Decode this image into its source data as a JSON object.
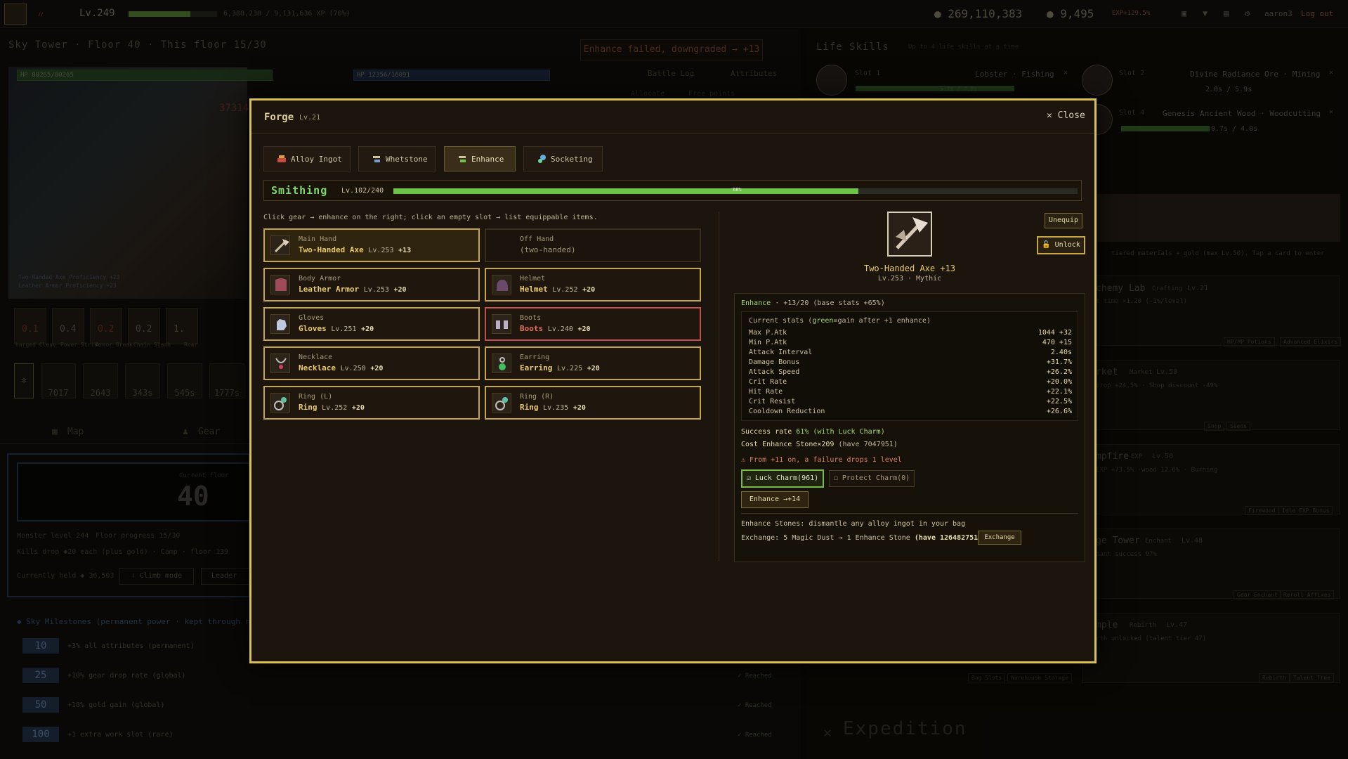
{
  "topbar": {
    "level": "Lv.249",
    "xp_text": "6,388,230 / 9,131,636 XP (70%)",
    "xp_progress": 0.7,
    "gold": "● 269,110,383",
    "gems": "● 9,495",
    "exp_bonus": "EXP+129.5%",
    "user": "aaron3",
    "logout": "Log out"
  },
  "left": {
    "breadcrumb": "Sky Tower · Floor 40 · This floor 15/30",
    "fail_message": "Enhance failed, downgraded → +13",
    "hp_player": "HP 80265/80265",
    "hp_enemy": "HP 12356/16091",
    "battle_log": "Battle Log",
    "attributes": "Attributes",
    "allocate": "Allocate",
    "free_points": "Free points",
    "damage_popup": "373146",
    "proficiency_1": "Two-Handed Axe Proficiency +23",
    "proficiency_2": "Leather Armor Proficiency +23",
    "skills": [
      {
        "name": "harged Cleav",
        "value": "0.1"
      },
      {
        "name": "Power Strike",
        "value": "0.4"
      },
      {
        "name": "Armor Break",
        "value": "0.2"
      },
      {
        "name": "Chain Slash",
        "value": "0.2"
      },
      {
        "name": "Roar",
        "value": "1."
      }
    ],
    "potions": [
      "7017",
      "2643",
      "343s",
      "545s",
      "1777s"
    ],
    "tab_map": "Map",
    "tab_gear": "Gear",
    "current_floor_label": "Current floor",
    "current_floor": "40",
    "monster_level": "Monster level 244",
    "floor_progress": "Floor progress 15/30",
    "kills_drop": "Kills drop ◆20 each (plus gold) · Camp · floor 139",
    "currently_held": "Currently held ◆ 36,503",
    "climb": "Climb mode",
    "leader": "Leader",
    "milestones_title": "◆ Sky Milestones (permanent power · kept through rebir",
    "milestones": [
      {
        "floor": "10",
        "text": "+3% all attributes (permanent)",
        "status": "✓ Reached"
      },
      {
        "floor": "25",
        "text": "+10% gear drop rate (global)",
        "status": "✓ Reached"
      },
      {
        "floor": "50",
        "text": "+10% gold gain (global)",
        "status": "✓ Reached"
      },
      {
        "floor": "100",
        "text": "+1 extra work slot (rare)",
        "status": "✓ Reached"
      }
    ]
  },
  "right": {
    "title": "Life Skills",
    "subtitle": "Up to 4 life skills at a time",
    "slot1_label": "Slot 1",
    "slot1_job": "Lobster · Fishing",
    "slot1_time": "5.7s / 7.8s",
    "slot2_label": "Slot 2",
    "slot2_job": "Divine Radiance Ore · Mining",
    "slot2_time": "2.0s / 5.9s",
    "slot4_label": "Slot 4",
    "slot4_job": "Genesis Ancient Wood · Woodcutting",
    "slot4_time": "0.7s / 4.0s",
    "materials_hint": "tiered materials + gold (max Lv.50). Tap a card to enter",
    "cards": [
      {
        "title": "chemy Lab",
        "tag": "Crafting",
        "lv": "Lv.21",
        "sub": "t time ×1.20 (-1%/level)",
        "b1": "HP/MP Potions",
        "b2": "Advanced Elixirs"
      },
      {
        "title": "rket",
        "tag": "Market",
        "lv": "Lv.50",
        "sub": "drop +24.5% · Shop discount -49%",
        "b1": "Shop",
        "b2": "Seeds"
      },
      {
        "title": "mpfire",
        "tag": "EXP",
        "lv": "Lv.50",
        "sub": "EXP +73.5% ·wood 12.6% · Burning",
        "b1": "Firewood",
        "b2": "Idle EXP Bonus"
      },
      {
        "title": "ge Tower",
        "tag": "Enchant",
        "lv": "Lv.48",
        "sub": "hant success 97%",
        "b1": "Gear Enchant",
        "b2": "Reroll Affixes"
      },
      {
        "title": "mple",
        "tag": "Rebirth",
        "lv": "Lv.47",
        "sub": "rth unlocked (talent tier 47)",
        "b1": "Rebirth",
        "b2": "Talent Tree"
      }
    ],
    "bag_slots": "Bag Slots",
    "warehouse": "Warehouse Storage",
    "expedition": "Expedition"
  },
  "forge": {
    "title": "Forge",
    "level": "Lv.21",
    "close": "✕ Close",
    "tabs": [
      "Alloy Ingot",
      "Whetstone",
      "Enhance",
      "Socketing"
    ],
    "active_tab": "Enhance",
    "smithing_title": "Smithing",
    "smithing_level": "Lv.102/240",
    "smithing_progress": 0.68,
    "smithing_mid": "68%",
    "hint": "Click gear → enhance on the right; click an empty slot → list equippable items.",
    "gear": [
      {
        "slot": "Main Hand",
        "name": "Two-Handed Axe",
        "lv": "Lv.253",
        "plus": "+13"
      },
      {
        "slot": "Off Hand",
        "sub": "(two-handed)"
      },
      {
        "slot": "Body Armor",
        "name": "Leather Armor",
        "lv": "Lv.253",
        "plus": "+20"
      },
      {
        "slot": "Helmet",
        "name": "Helmet",
        "lv": "Lv.252",
        "plus": "+20"
      },
      {
        "slot": "Gloves",
        "name": "Gloves",
        "lv": "Lv.251",
        "plus": "+20"
      },
      {
        "slot": "Boots",
        "name": "Boots",
        "lv": "Lv.240",
        "plus": "+20"
      },
      {
        "slot": "Necklace",
        "name": "Necklace",
        "lv": "Lv.250",
        "plus": "+20"
      },
      {
        "slot": "Earring",
        "name": "Earring",
        "lv": "Lv.225",
        "plus": "+20"
      },
      {
        "slot": "Ring (L)",
        "name": "Ring",
        "lv": "Lv.252",
        "plus": "+20"
      },
      {
        "slot": "Ring (R)",
        "name": "Ring",
        "lv": "Lv.235",
        "plus": "+20"
      }
    ],
    "item_name": "Two-Handed Axe +13",
    "item_sub": "Lv.253 · Mythic",
    "unequip": "Unequip",
    "unlock": "🔓 Unlock",
    "enhance_label": "Enhance",
    "enhance_progress": "· +13/20 (base stats +65%)",
    "stats_title_a": "Current stats (",
    "stats_title_g": "green",
    "stats_title_b": "=gain after +1 enhance)",
    "stats": [
      {
        "name": "Max P.Atk",
        "value": "1044 +32"
      },
      {
        "name": "Min P.Atk",
        "value": "470 +15"
      },
      {
        "name": "Attack Interval",
        "value": "2.40s"
      },
      {
        "name": "Damage Bonus",
        "value": "+31.7%"
      },
      {
        "name": "Attack Speed",
        "value": "+26.2%"
      },
      {
        "name": "Crit Rate",
        "value": "+20.0%"
      },
      {
        "name": "Hit Rate",
        "value": "+22.1%"
      },
      {
        "name": "Crit Resist",
        "value": "+22.5%"
      },
      {
        "name": "Cooldown Reduction",
        "value": "+26.6%"
      }
    ],
    "success_a": "Success rate",
    "success_b": "61% (with Luck Charm)",
    "cost_a": "Cost Enhance Stone×209",
    "cost_b": "(have 7047951)",
    "warning": "⚠ From +11 on, a failure drops 1 level",
    "luck_charm": "☑ Luck Charm(961)",
    "protect_charm": "☐ Protect Charm(0)",
    "enhance_button": "Enhance →+14",
    "stones_hint": "Enhance Stones: dismantle any alloy ingot in your bag",
    "exchange_a": "Exchange: 5 Magic Dust → 1 Enhance Stone",
    "exchange_b": "(have 126482751)",
    "exchange_button": "Exchange"
  },
  "colors": {
    "accent_gold": "#d8c056",
    "green": "#6cc346",
    "danger": "#c05050"
  }
}
